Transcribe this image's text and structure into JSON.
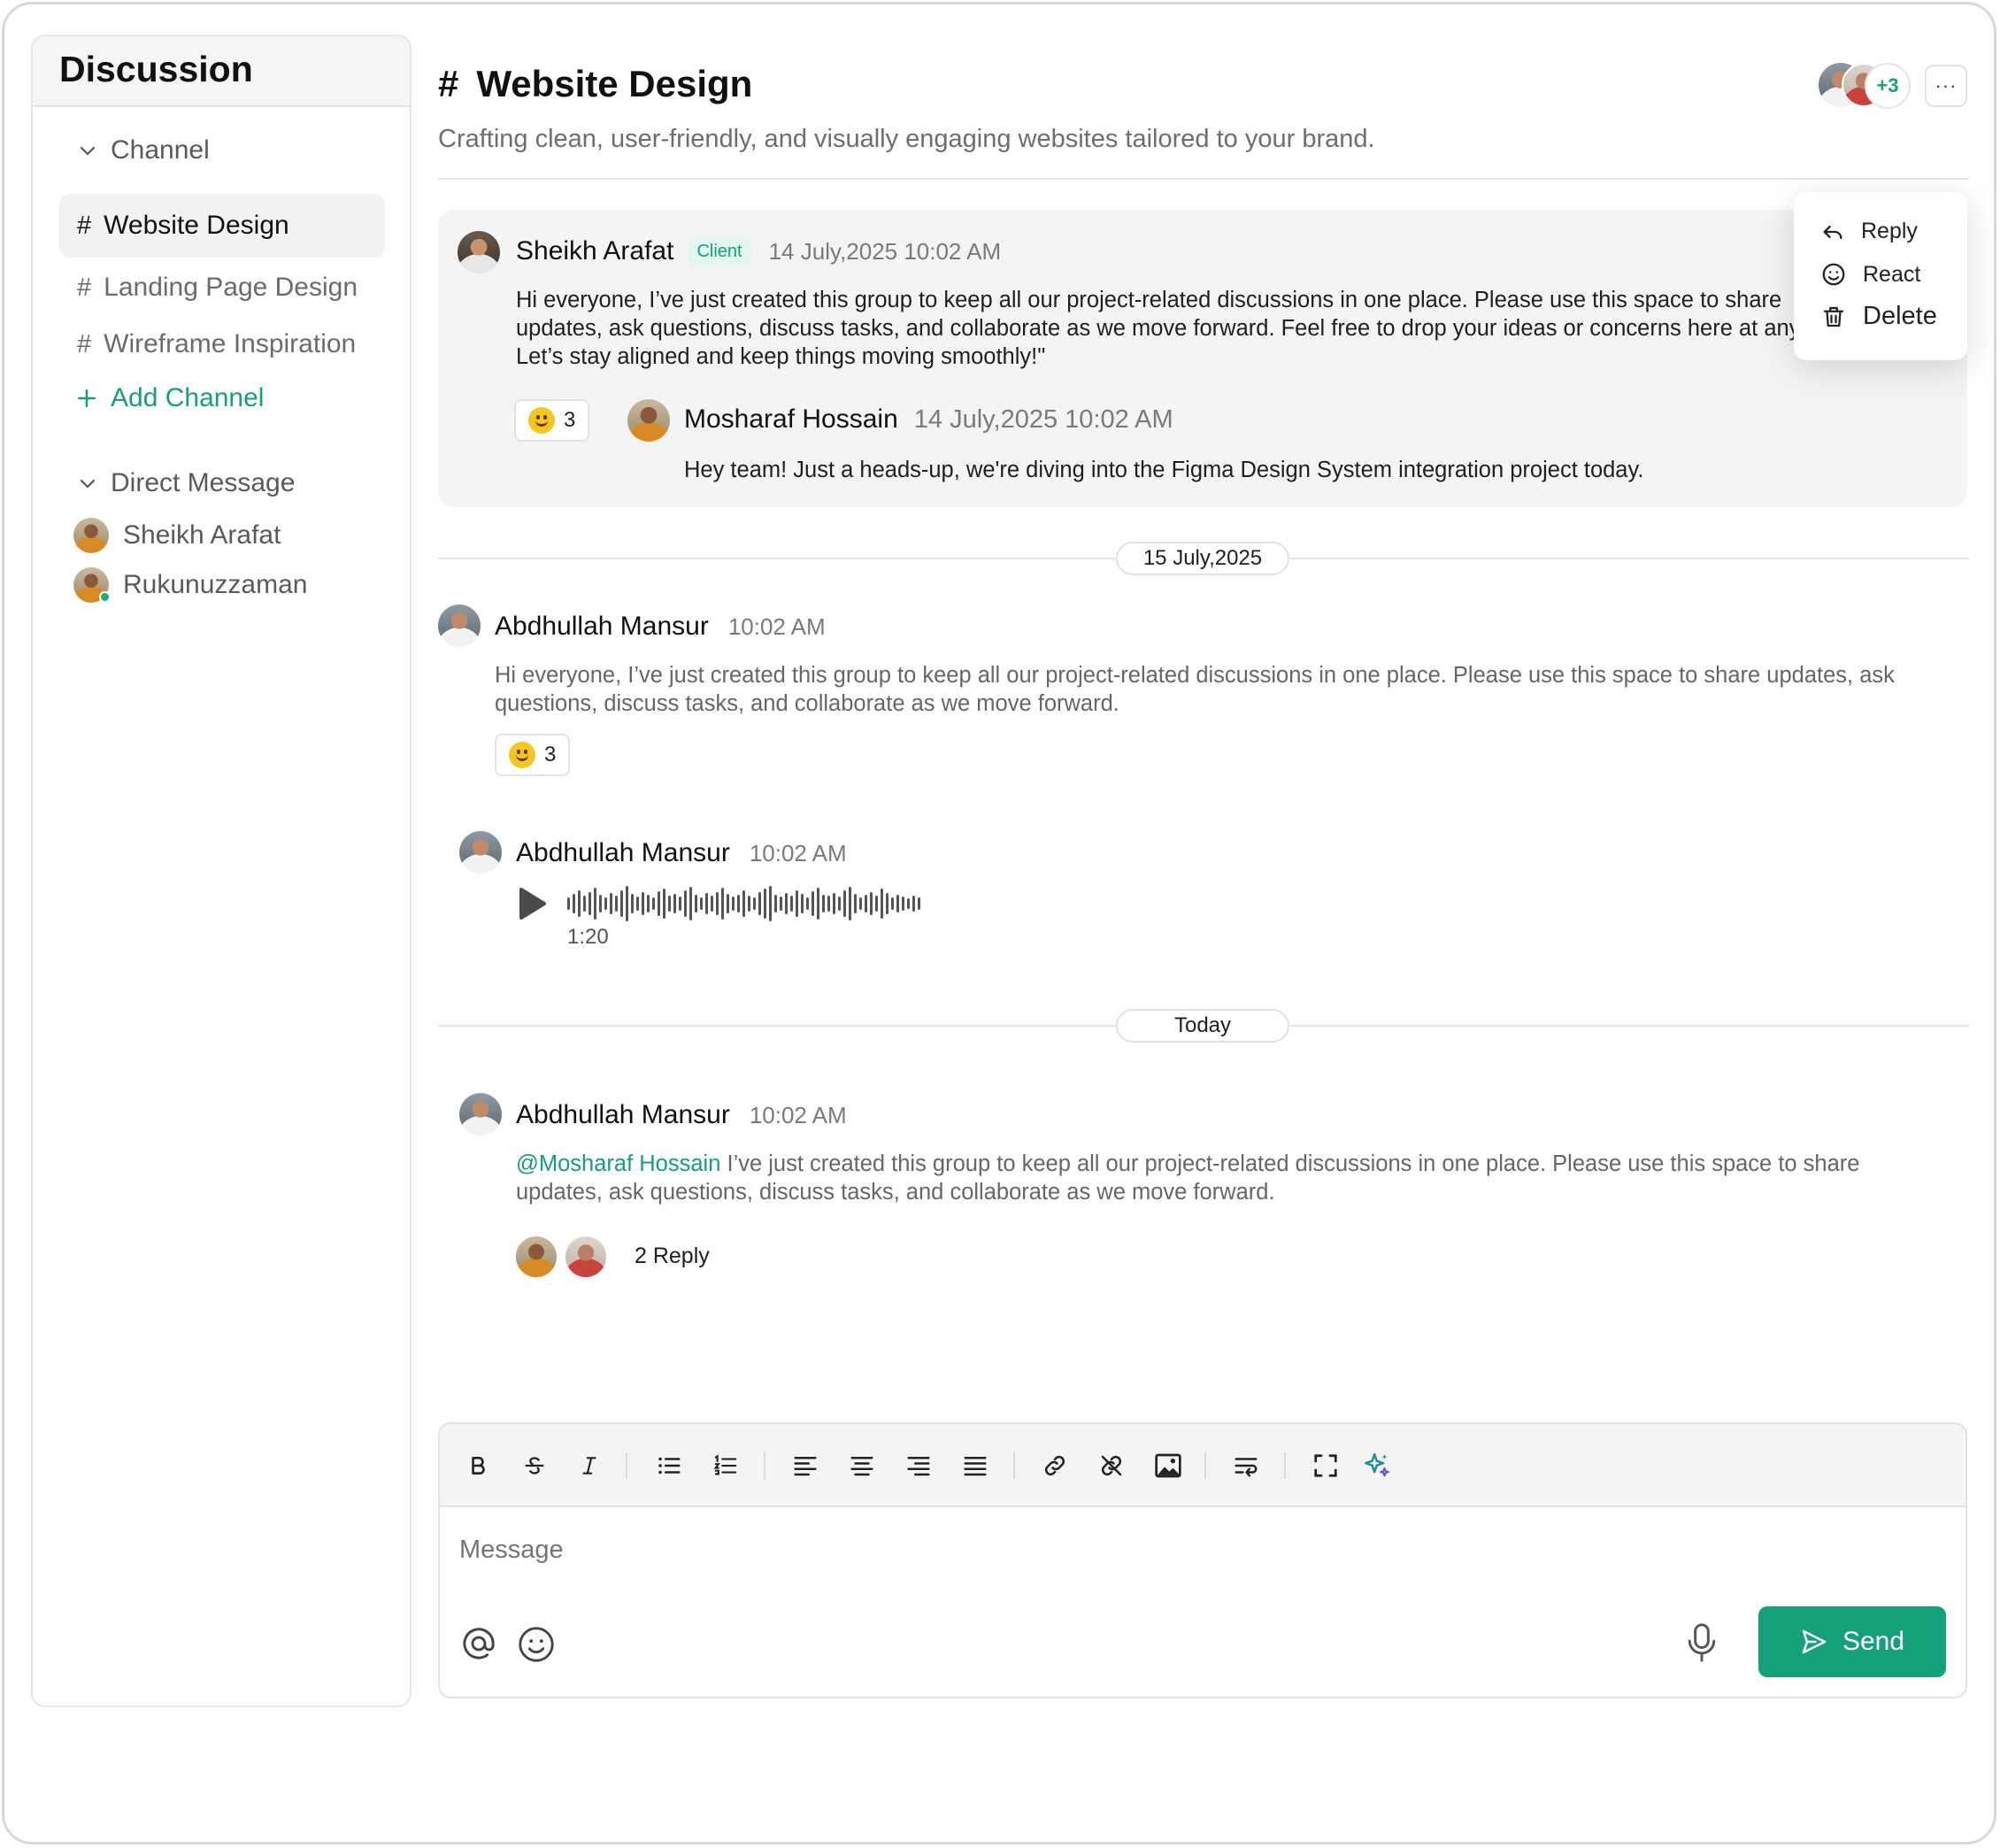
{
  "sidebar": {
    "title": "Discussion",
    "channel_section": "Channel",
    "channels": [
      {
        "label": "Website Design",
        "active": true
      },
      {
        "label": "Landing Page Design",
        "active": false
      },
      {
        "label": "Wireframe Inspiration",
        "active": false
      }
    ],
    "add_channel": "Add Channel",
    "dm_section": "Direct Message",
    "direct_messages": [
      {
        "name": "Sheikh Arafat"
      },
      {
        "name": "Rukunuzzaman",
        "online": true
      }
    ]
  },
  "header": {
    "hash": "#",
    "title": "Website Design",
    "description": "Crafting clean, user-friendly, and visually engaging websites tailored to your brand.",
    "member_more": "+3",
    "more_icon": "ellipsis-icon"
  },
  "thread": {
    "author": "Sheikh Arafat",
    "badge": "Client",
    "time": "14 July,2025 10:02 AM",
    "body": "Hi everyone, I’ve just created this group to keep all our project-related discussions in one place. Please use this space to share updates, ask questions, discuss tasks, and collaborate as we move forward. Feel free to drop your ideas or concerns here at any time. Let’s stay aligned and keep things moving smoothly!\"",
    "reaction_count": "3",
    "reply": {
      "author": "Mosharaf Hossain",
      "time": "14 July,2025 10:02 AM",
      "body": "Hey team! Just a heads-up, we're diving into the Figma Design System integration project today."
    }
  },
  "context_menu": {
    "reply": "Reply",
    "react": "React",
    "delete": "Delete"
  },
  "divider1": "15 July,2025",
  "message1": {
    "author": "Abdhullah Mansur",
    "time": "10:02 AM",
    "body": "Hi everyone, I’ve just created this group to keep all our project-related discussions in one place. Please use this space to share updates, ask questions, discuss tasks, and collaborate as we move forward.",
    "reaction_count": "3"
  },
  "message2": {
    "author": "Abdhullah Mansur",
    "time": "10:02 AM",
    "voice_duration": "1:20"
  },
  "divider2": "Today",
  "message3": {
    "author": "Abdhullah Mansur",
    "time": "10:02 AM",
    "mention": "@Mosharaf Hossain",
    "body": " I’ve just created this group to keep all our project-related discussions in one place. Please use this space to share updates, ask questions, discuss tasks, and collaborate as we move forward.",
    "replies": "2 Reply"
  },
  "composer": {
    "placeholder": "Message",
    "send_label": "Send",
    "toolbar_icons": [
      "bold-icon",
      "strikethrough-icon",
      "italic-icon",
      "bullet-list-icon",
      "numbered-list-icon",
      "align-left-icon",
      "align-center-icon",
      "align-right-icon",
      "align-justify-icon",
      "link-icon",
      "unlink-icon",
      "image-icon",
      "text-wrap-icon",
      "fullscreen-icon",
      "ai-sparkle-icon"
    ]
  },
  "colors": {
    "accent": "#14a07a",
    "mention": "#14a07a",
    "badge_bg": "#e4f7ef"
  }
}
